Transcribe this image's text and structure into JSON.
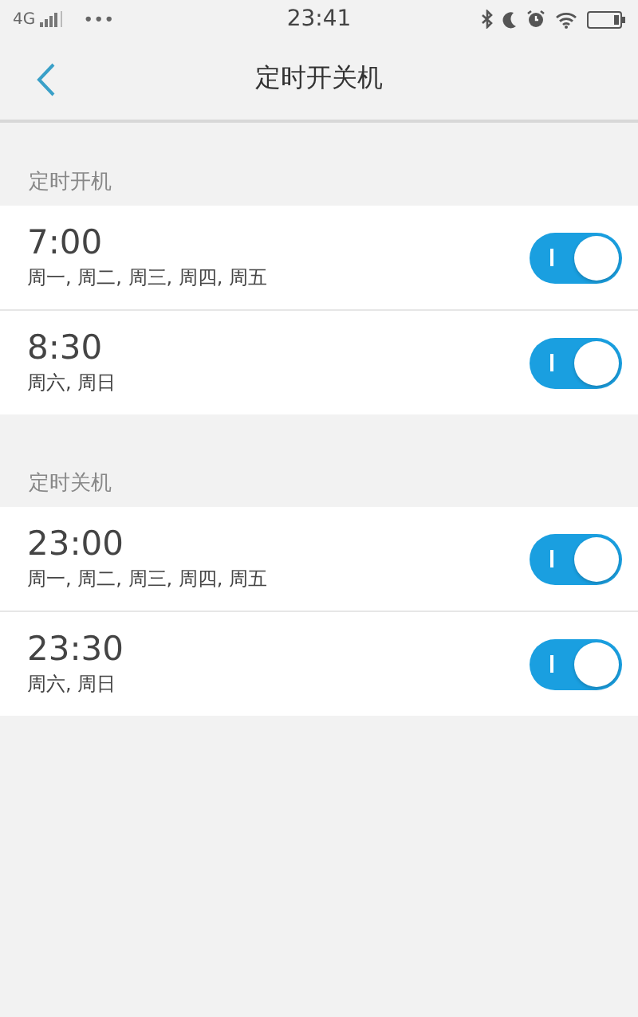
{
  "status_bar": {
    "network": "4G",
    "menu": "•••",
    "time": "23:41"
  },
  "nav": {
    "title": "定时开关机"
  },
  "sections": [
    {
      "title": "定时开机",
      "items": [
        {
          "time": "7:00",
          "days": "周一, 周二, 周三, 周四, 周五",
          "on": true
        },
        {
          "time": "8:30",
          "days": "周六, 周日",
          "on": true
        }
      ]
    },
    {
      "title": "定时关机",
      "items": [
        {
          "time": "23:00",
          "days": "周一, 周二, 周三, 周四, 周五",
          "on": true
        },
        {
          "time": "23:30",
          "days": "周六, 周日",
          "on": true
        }
      ]
    }
  ]
}
